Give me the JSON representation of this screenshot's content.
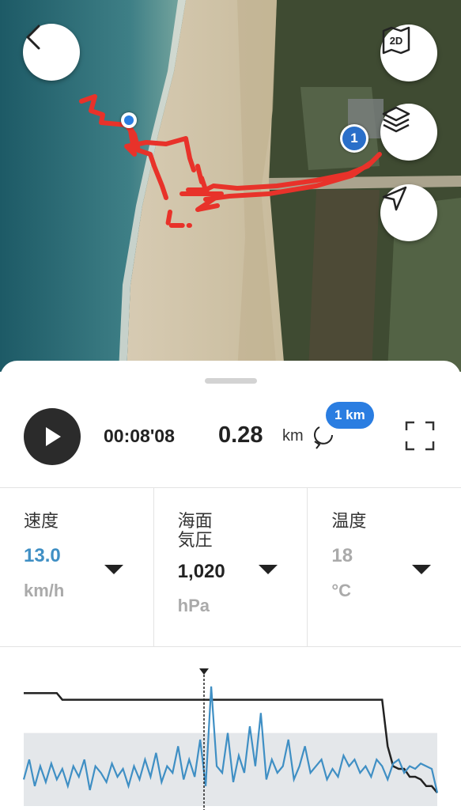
{
  "map": {
    "view_mode_label": "2D",
    "lap_marker_label": "1",
    "icons": [
      "back-arrow-icon",
      "map-2d-icon",
      "layers-icon",
      "location-arrow-icon"
    ],
    "colors": {
      "track": "#e8322a",
      "position": "#2a7de1"
    }
  },
  "playback": {
    "elapsed": "00:08'08",
    "distance": "0.28",
    "distance_unit": "km",
    "lap_badge": "1 km"
  },
  "stats": [
    {
      "label_line1": "速度",
      "label_line2": "",
      "value": "13.0",
      "unit": "km/h",
      "value_color": "#3f8fc4",
      "unit_color": "#aaaaaa"
    },
    {
      "label_line1": "海面",
      "label_line2": "気圧",
      "value": "1,020",
      "unit": "hPa",
      "value_color": "#222222",
      "unit_color": "#aaaaaa"
    },
    {
      "label_line1": "温度",
      "label_line2": "",
      "value": "18",
      "unit": "°C",
      "value_color": "#aaaaaa",
      "unit_color": "#aaaaaa"
    }
  ],
  "chart_data": {
    "type": "line",
    "series": [
      {
        "values": [
          0.55,
          0.55,
          0.55,
          0.55,
          0.55,
          0.55,
          0.55,
          0.55,
          0.55,
          0.55,
          0.55,
          0.55,
          0.55,
          0.55,
          0.55,
          0.55,
          0.55,
          0.55,
          0.55,
          0.55,
          0.55,
          0.55,
          0.55,
          0.55,
          0.55,
          0.55,
          0.55,
          0.55,
          0.55,
          0.55,
          0.55,
          0.55,
          0.55,
          0.55,
          0.55,
          0.55,
          0.55,
          0.55,
          0.55,
          0.55,
          0.55,
          0.55,
          0.55,
          0.55,
          0.55,
          0.55,
          0.55,
          0.55,
          0.55,
          0.55,
          0.55,
          0.55,
          0.55,
          0.55,
          0.55,
          0.55,
          0.55,
          0.55,
          0.55,
          0.55,
          0.55,
          0.55,
          0.55,
          0.55,
          0.55,
          0.55,
          0.55,
          0.55,
          0.55,
          0.55,
          0.55,
          0.55,
          0.55,
          0.55,
          0.55,
          0.55
        ]
      },
      {
        "values": [
          0.85,
          0.85,
          0.85,
          0.85,
          0.85,
          0.85,
          0.85,
          0.8,
          0.8,
          0.8,
          0.8,
          0.8,
          0.8,
          0.8,
          0.8,
          0.8,
          0.8,
          0.8,
          0.8,
          0.8,
          0.8,
          0.8,
          0.8,
          0.8,
          0.8,
          0.8,
          0.8,
          0.8,
          0.8,
          0.8,
          0.8,
          0.8,
          0.8,
          0.8,
          0.8,
          0.8,
          0.8,
          0.8,
          0.8,
          0.8,
          0.8,
          0.8,
          0.8,
          0.8,
          0.8,
          0.8,
          0.8,
          0.8,
          0.8,
          0.8,
          0.8,
          0.8,
          0.8,
          0.8,
          0.8,
          0.8,
          0.8,
          0.8,
          0.8,
          0.8,
          0.8,
          0.8,
          0.8,
          0.8,
          0.8,
          0.8,
          0.45,
          0.3,
          0.28,
          0.28,
          0.22,
          0.22,
          0.2,
          0.15,
          0.15,
          0.1
        ]
      },
      {
        "values": [
          0.2,
          0.35,
          0.15,
          0.3,
          0.18,
          0.32,
          0.2,
          0.28,
          0.15,
          0.3,
          0.22,
          0.35,
          0.12,
          0.3,
          0.25,
          0.18,
          0.32,
          0.22,
          0.28,
          0.15,
          0.3,
          0.2,
          0.35,
          0.22,
          0.4,
          0.18,
          0.3,
          0.25,
          0.45,
          0.2,
          0.35,
          0.22,
          0.5,
          0.15,
          0.9,
          0.3,
          0.25,
          0.55,
          0.18,
          0.38,
          0.25,
          0.6,
          0.3,
          0.7,
          0.2,
          0.35,
          0.25,
          0.3,
          0.5,
          0.2,
          0.3,
          0.45,
          0.25,
          0.3,
          0.35,
          0.2,
          0.28,
          0.22,
          0.38,
          0.3,
          0.35,
          0.25,
          0.3,
          0.22,
          0.35,
          0.3,
          0.2,
          0.32,
          0.35,
          0.25,
          0.3,
          0.28,
          0.32,
          0.3,
          0.28,
          0.1
        ]
      }
    ]
  }
}
